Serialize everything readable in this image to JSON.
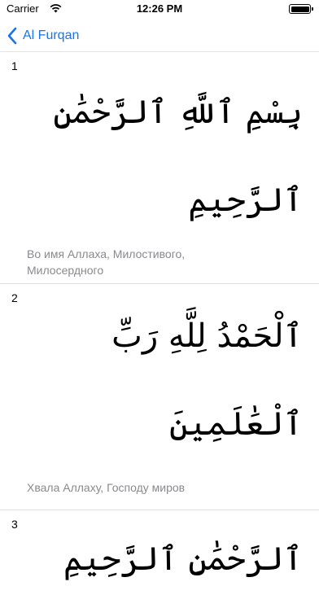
{
  "status_bar": {
    "carrier": "Carrier",
    "time": "12:26 PM"
  },
  "nav": {
    "back_label": "Al Furqan"
  },
  "colors": {
    "accent": "#1a73e8",
    "highlight_blue": "#3a5fd9",
    "muted_gray": "#a6a6ab",
    "translation_gray": "#8a8a8e"
  },
  "verses": [
    {
      "number": "1",
      "arabic_line1": "بِسْمِ ٱللَّهِ ٱلرَّحْمَٰنِ",
      "arabic_line2": "ٱلرَّحِيمِ",
      "translation": "Во имя Аллаха, Милостивого, Милосердного"
    },
    {
      "number": "2",
      "arabic_line1": "ٱلْحَمْدُ لِلَّهِ رَبِّ",
      "arabic_line2": "ٱلْعَٰلَمِينَ",
      "translation": "Хвала Аллаху, Господу миров"
    },
    {
      "number": "3",
      "arabic_line1": "ٱلرَّحْمَٰنِ ٱلرَّحِيمِ"
    }
  ]
}
